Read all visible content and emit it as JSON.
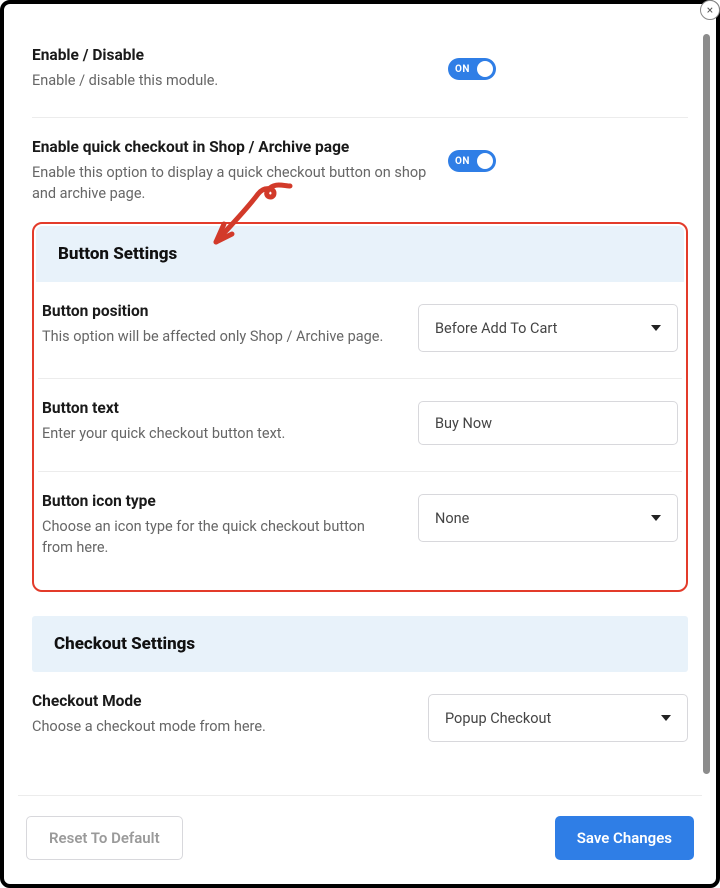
{
  "close": {
    "glyph": "×"
  },
  "settings": {
    "enable": {
      "title": "Enable / Disable",
      "desc": "Enable / disable this module.",
      "toggle_text": "ON"
    },
    "quick_checkout": {
      "title": "Enable quick checkout in Shop / Archive page",
      "desc": "Enable this option to display a quick checkout button on shop and archive page.",
      "toggle_text": "ON"
    }
  },
  "button_settings": {
    "header": "Button Settings",
    "position": {
      "title": "Button position",
      "desc": "This option will be affected only Shop / Archive page.",
      "value": "Before Add To Cart"
    },
    "text": {
      "title": "Button text",
      "desc": "Enter your quick checkout button text.",
      "value": "Buy Now"
    },
    "icon": {
      "title": "Button icon type",
      "desc": "Choose an icon type for the quick checkout button from here.",
      "value": "None"
    }
  },
  "checkout_settings": {
    "header": "Checkout Settings",
    "mode": {
      "title": "Checkout Mode",
      "desc": "Choose a checkout mode from here.",
      "value": "Popup Checkout"
    }
  },
  "footer": {
    "reset": "Reset To Default",
    "save": "Save Changes"
  }
}
